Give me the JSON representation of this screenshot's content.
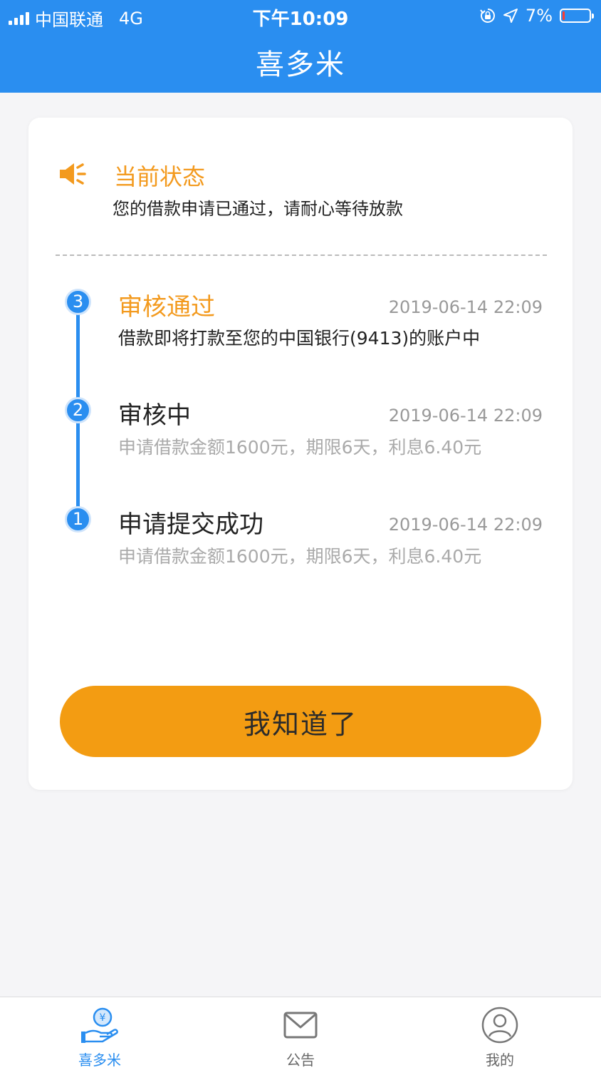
{
  "status_bar": {
    "carrier": "中国联通",
    "network": "4G",
    "time": "下午10:09",
    "battery": "7%",
    "battery_level": 0.07
  },
  "nav": {
    "title": "喜多米"
  },
  "status_card": {
    "icon": "speaker-icon",
    "title": "当前状态",
    "description": "您的借款申请已通过，请耐心等待放款"
  },
  "steps": [
    {
      "number": "3",
      "title": "审核通过",
      "time": "2019-06-14 22:09",
      "description": "借款即将打款至您的中国银行(9413)的账户中"
    },
    {
      "number": "2",
      "title": "审核中",
      "time": "2019-06-14 22:09",
      "description": "申请借款金额1600元，期限6天，利息6.40元"
    },
    {
      "number": "1",
      "title": "申请提交成功",
      "time": "2019-06-14 22:09",
      "description": "申请借款金额1600元，期限6天，利息6.40元"
    }
  ],
  "button": {
    "label": "我知道了"
  },
  "tabbar": {
    "items": [
      {
        "label": "喜多米",
        "icon": "yen-hand-icon",
        "active": true
      },
      {
        "label": "公告",
        "icon": "envelope-icon",
        "active": false
      },
      {
        "label": "我的",
        "icon": "user-icon",
        "active": false
      }
    ]
  },
  "colors": {
    "primary": "#2a8ef0",
    "accent": "#f39a1e",
    "button": "#f39c12",
    "battery_low": "#ff3b30"
  }
}
